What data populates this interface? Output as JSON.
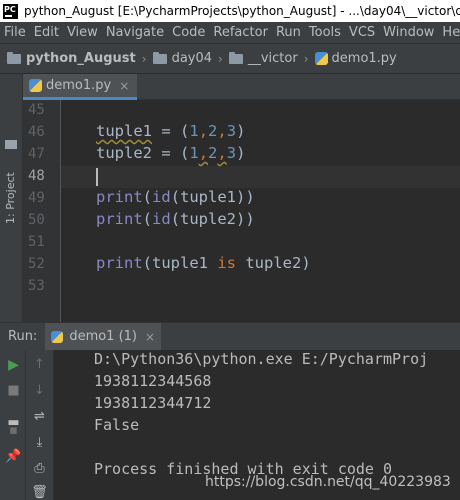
{
  "window": {
    "logo_text": "PC",
    "title": "python_August [E:\\PycharmProjects\\python_August] - ...\\day04\\__victor\\dem"
  },
  "menu": [
    "File",
    "Edit",
    "View",
    "Navigate",
    "Code",
    "Refactor",
    "Run",
    "Tools",
    "VCS",
    "Window",
    "He"
  ],
  "breadcrumb": [
    "python_August",
    "day04",
    "__victor",
    "demo1.py"
  ],
  "side_panel": {
    "label": "1: Project"
  },
  "editor_tab": {
    "label": "demo1.py",
    "close": "×"
  },
  "editor": {
    "line_numbers": [
      "45",
      "46",
      "47",
      "48",
      "49",
      "50",
      "51",
      "52",
      "53"
    ],
    "current_line": "48",
    "code": {
      "l46": {
        "var": "tuple1",
        "op": " = ",
        "open": "(",
        "n1": "1",
        "c1": ",",
        "n2": "2",
        "c2": ",",
        "n3": "3",
        "close": ")"
      },
      "l47": {
        "var": "tuple2",
        "op": " = ",
        "open": "(",
        "n1": "1",
        "c1": ",",
        "n2": "2",
        "c2": ",",
        "n3": "3",
        "close": ")"
      },
      "l49": {
        "fn": "print",
        "open": "(",
        "fn2": "id",
        "arg": "(tuple1))"
      },
      "l50": {
        "fn": "print",
        "open": "(",
        "fn2": "id",
        "arg": "(tuple2))"
      },
      "l52": {
        "fn": "print",
        "open": "(tuple1 ",
        "kw": "is",
        "rest": " tuple2)"
      }
    }
  },
  "run_panel": {
    "title": "Run:",
    "tab_label": "demo1 (1)",
    "close": "×",
    "output": [
      "D:\\Python36\\python.exe E:/PycharmProj",
      "1938112344568",
      "1938112344712",
      "False",
      "",
      "Process finished with exit code 0"
    ]
  },
  "watermark": "https://blog.csdn.net/qq_40223983"
}
